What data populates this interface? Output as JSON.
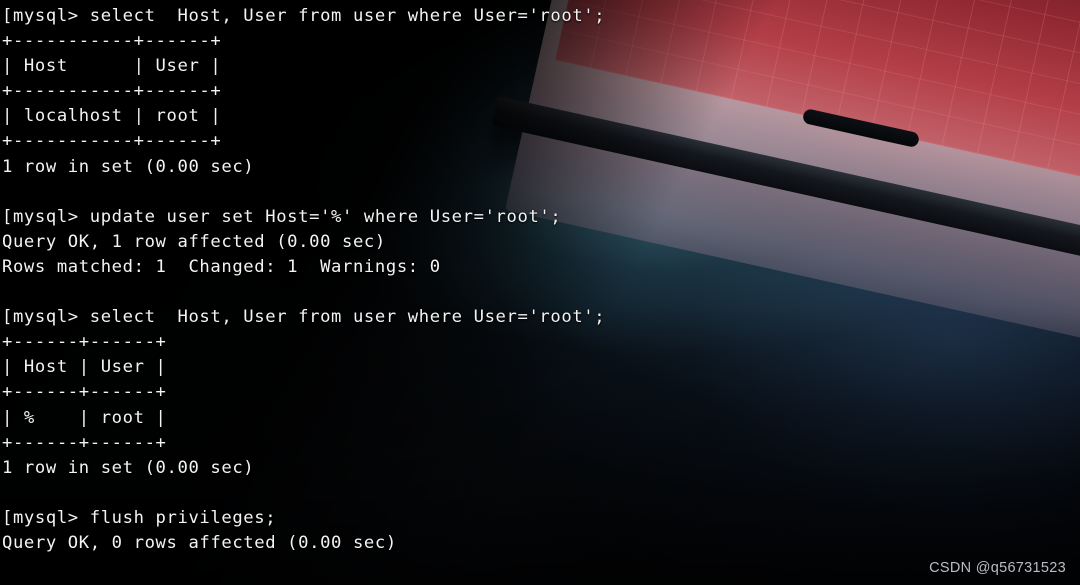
{
  "app": {
    "kind": "terminal",
    "shell_prompt": "mysql>",
    "text_color": "#f2f3f3",
    "background_color": "#020305",
    "accent_teal": "#6eb9cd",
    "accent_red": "#e86060"
  },
  "wallpaper": {
    "description": "laptop-photo-wallpaper",
    "keyboard_glow_color": "#b0343e",
    "desk_glow_color": "#6eb9cd",
    "haze_color": "#263e60"
  },
  "terminal": {
    "lines": [
      "[mysql> select  Host, User from user where User='root';",
      "+-----------+------+",
      "| Host      | User |",
      "+-----------+------+",
      "| localhost | root |",
      "+-----------+------+",
      "1 row in set (0.00 sec)",
      "",
      "[mysql> update user set Host='%' where User='root';",
      "Query OK, 1 row affected (0.00 sec)",
      "Rows matched: 1  Changed: 1  Warnings: 0",
      "",
      "[mysql> select  Host, User from user where User='root';",
      "+------+------+",
      "| Host | User |",
      "+------+------+",
      "| %    | root |",
      "+------+------+",
      "1 row in set (0.00 sec)",
      "",
      "[mysql> flush privileges;",
      "Query OK, 0 rows affected (0.00 sec)"
    ],
    "commands": [
      "select  Host, User from user where User='root';",
      "update user set Host='%' where User='root';",
      "select  Host, User from user where User='root';",
      "flush privileges;"
    ],
    "result_tables": [
      {
        "headers": [
          "Host",
          "User"
        ],
        "rows": [
          [
            "localhost",
            "root"
          ]
        ],
        "footer": "1 row in set (0.00 sec)"
      },
      {
        "headers": [
          "Host",
          "User"
        ],
        "rows": [
          [
            "%",
            "root"
          ]
        ],
        "footer": "1 row in set (0.00 sec)"
      }
    ],
    "status_messages": [
      "Query OK, 1 row affected (0.00 sec)",
      "Rows matched: 1  Changed: 1  Warnings: 0",
      "Query OK, 0 rows affected (0.00 sec)"
    ]
  },
  "watermark": {
    "text": "CSDN @q56731523"
  }
}
